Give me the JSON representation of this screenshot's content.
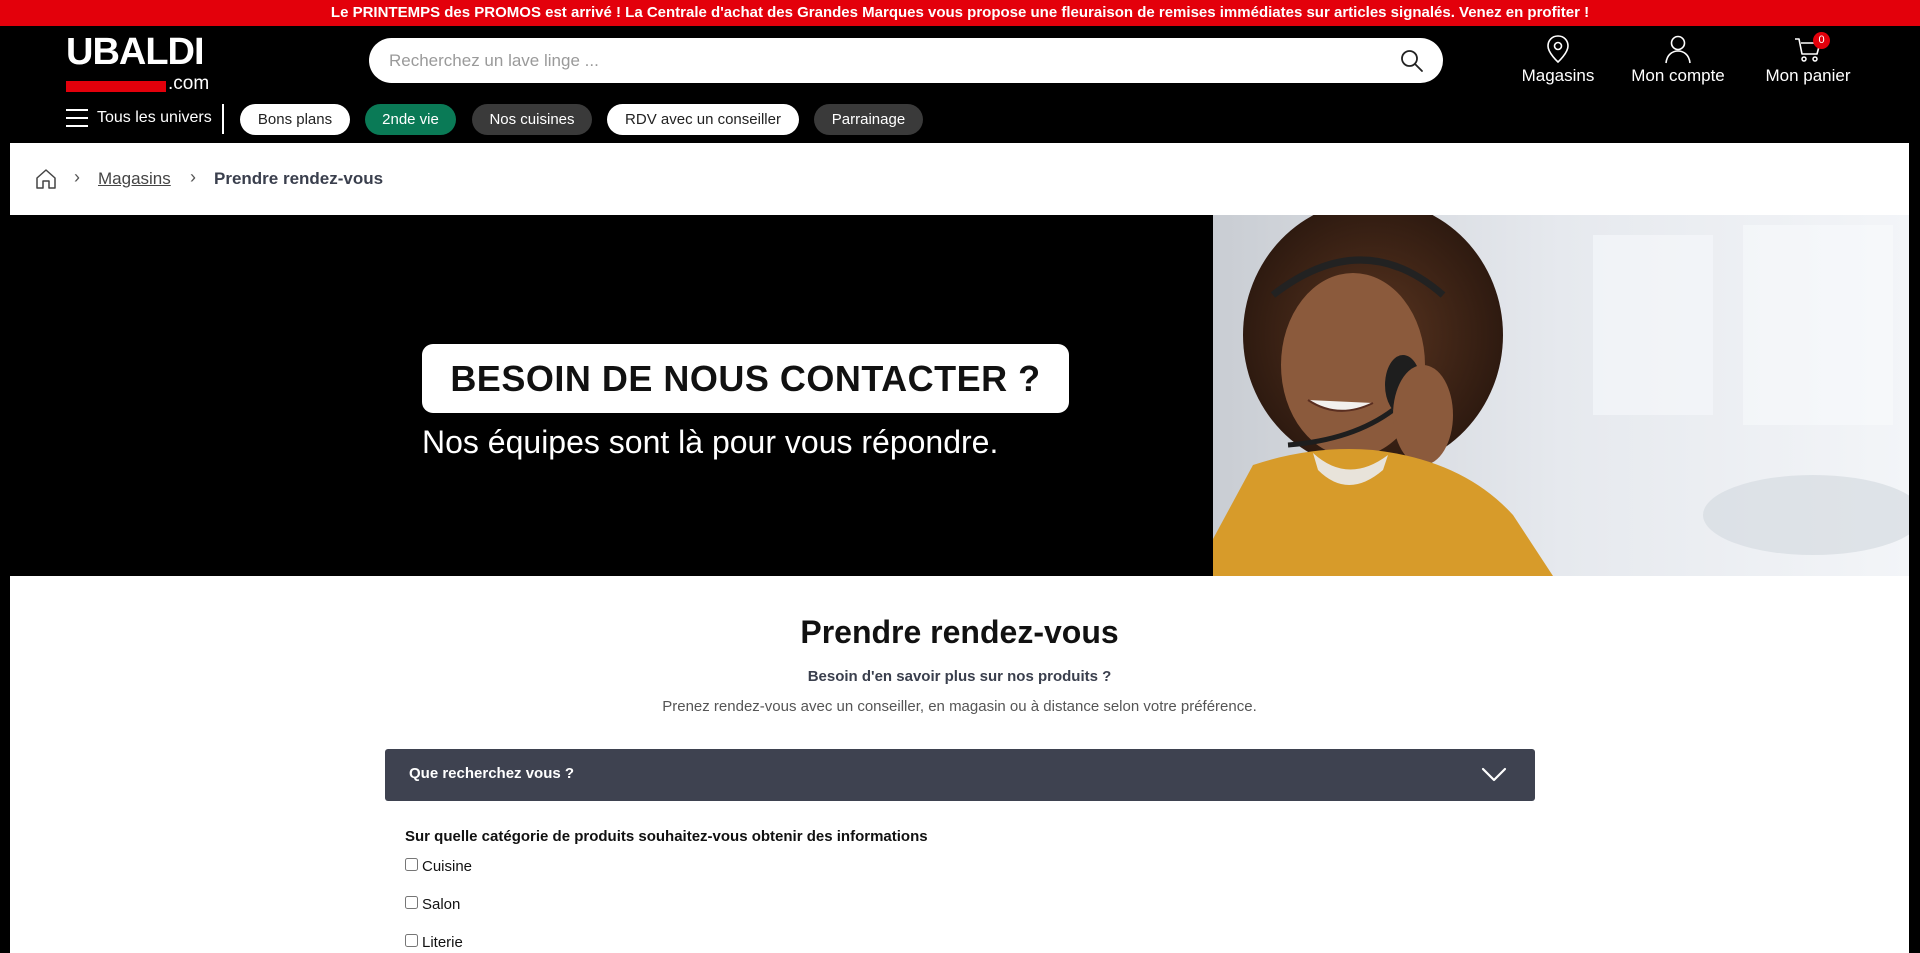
{
  "promo_bar": {
    "text": "Le PRINTEMPS des PROMOS est arrivé ! La Centrale d'achat des Grandes Marques vous propose une fleuraison de remises immédiates sur articles signalés. Venez en profiter !",
    "color": "#e3000b"
  },
  "logo": {
    "word": "UBALDI",
    "suffix": ".com"
  },
  "search": {
    "placeholder": "Recherchez un lave linge ...",
    "value": ""
  },
  "header_actions": {
    "stores": {
      "label": "Magasins",
      "icon": "map-pin-icon"
    },
    "account": {
      "label": "Mon compte",
      "icon": "user-icon"
    },
    "cart": {
      "label": "Mon panier",
      "icon": "cart-icon",
      "count": "0"
    }
  },
  "nav": {
    "menu_label": "Tous les univers",
    "pills": [
      "Bons plans",
      "2nde vie",
      "Nos cuisines",
      "RDV avec un conseiller",
      "Parrainage"
    ]
  },
  "breadcrumb": {
    "link": "Magasins",
    "current": "Prendre rendez-vous",
    "separator": "›"
  },
  "banner": {
    "title": "BESOIN DE NOUS CONTACTER ?",
    "subtitle": "Nos équipes sont là pour vous répondre."
  },
  "form": {
    "title": "Prendre rendez-vous",
    "subtitle": "Besoin d'en savoir plus sur nos produits ?",
    "description": "Prenez rendez-vous avec un conseiller, en magasin ou à distance selon votre préférence.",
    "accordion_label": "Que recherchez vous ?",
    "question": "Sur quelle catégorie de produits souhaitez-vous obtenir des informations",
    "options": [
      "Cuisine",
      "Salon",
      "Literie"
    ]
  },
  "colors": {
    "accent_red": "#e3000b",
    "green_pill": "#0a7a56",
    "accordion_bg": "#3e4250"
  }
}
